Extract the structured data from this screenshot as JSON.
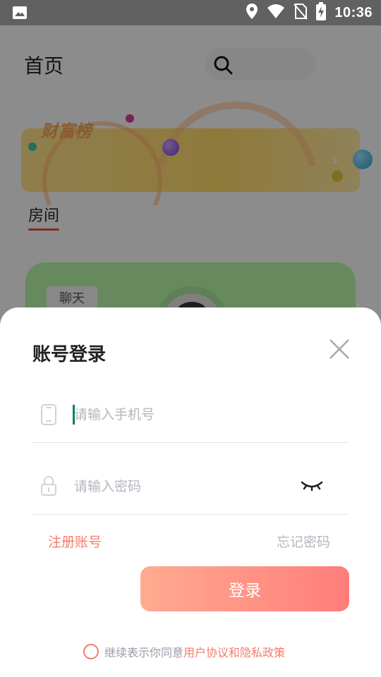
{
  "status_bar": {
    "time": "10:36",
    "icons": [
      "image-icon",
      "location-icon",
      "wifi-icon",
      "no-sim-icon",
      "battery-charging-icon"
    ]
  },
  "background": {
    "page_title": "首页",
    "search_icon": "search-icon",
    "banner_title": "财富榜",
    "rooms_tab": "房间",
    "room_card_chip": "聊天"
  },
  "login_sheet": {
    "title": "账号登录",
    "close_icon": "close-icon",
    "phone_placeholder": "请输入手机号",
    "phone_value": "",
    "password_placeholder": "请输入密码",
    "password_value": "",
    "register_link": "注册账号",
    "forgot_link": "忘记密码",
    "login_button": "登录",
    "agreement": {
      "prefix": "继续表示你同意",
      "user_agreement": "用户协议",
      "and": "和",
      "privacy_policy": "隐私政策",
      "checked": false
    }
  },
  "colors": {
    "accent": "#f47c6a",
    "button_start": "#ffab90",
    "button_end": "#ff7d7a",
    "placeholder": "#b5b5bf",
    "caret": "#0d7d6b"
  }
}
